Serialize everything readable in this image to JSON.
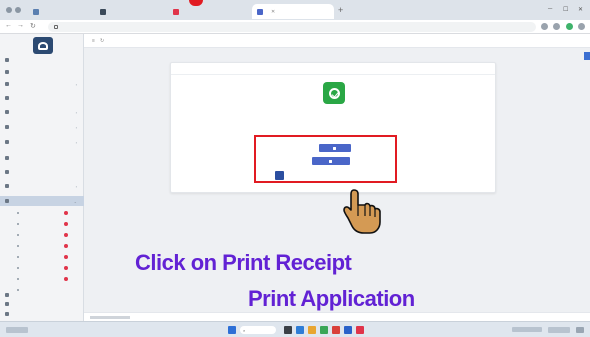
{
  "browser": {
    "tabs": [
      {
        "label": "",
        "active": false
      },
      {
        "label": "",
        "active": false
      },
      {
        "label": "",
        "active": false
      },
      {
        "label": "",
        "active": true
      }
    ],
    "url": ""
  },
  "sidebar": {
    "items": [
      {
        "label": ""
      },
      {
        "label": ""
      },
      {
        "label": ""
      },
      {
        "label": ""
      },
      {
        "label": ""
      },
      {
        "label": ""
      },
      {
        "label": ""
      },
      {
        "label": ""
      },
      {
        "label": ""
      },
      {
        "label": ""
      },
      {
        "label": ""
      },
      {
        "label": ""
      }
    ],
    "subitems": [
      {
        "label": ""
      },
      {
        "label": ""
      },
      {
        "label": ""
      },
      {
        "label": ""
      },
      {
        "label": ""
      },
      {
        "label": ""
      },
      {
        "label": ""
      },
      {
        "label": ""
      }
    ],
    "bottom_items": [
      {
        "label": ""
      },
      {
        "label": ""
      },
      {
        "label": ""
      }
    ]
  },
  "card": {
    "title": "",
    "heading": "",
    "message": "",
    "print_receipt_label": "",
    "print_application_label": "",
    "auth_text": ""
  },
  "instructions": {
    "line1": "Click on  Print Receipt",
    "line2": "Print Application"
  },
  "colors": {
    "accent": "#4a66c8",
    "success": "#2aa745",
    "highlight": "#e11b22",
    "instruction_text": "#6222d4"
  },
  "icons": [
    "success-check-icon",
    "pointing-hand-icon",
    "printer-icon",
    "logo-icon"
  ]
}
